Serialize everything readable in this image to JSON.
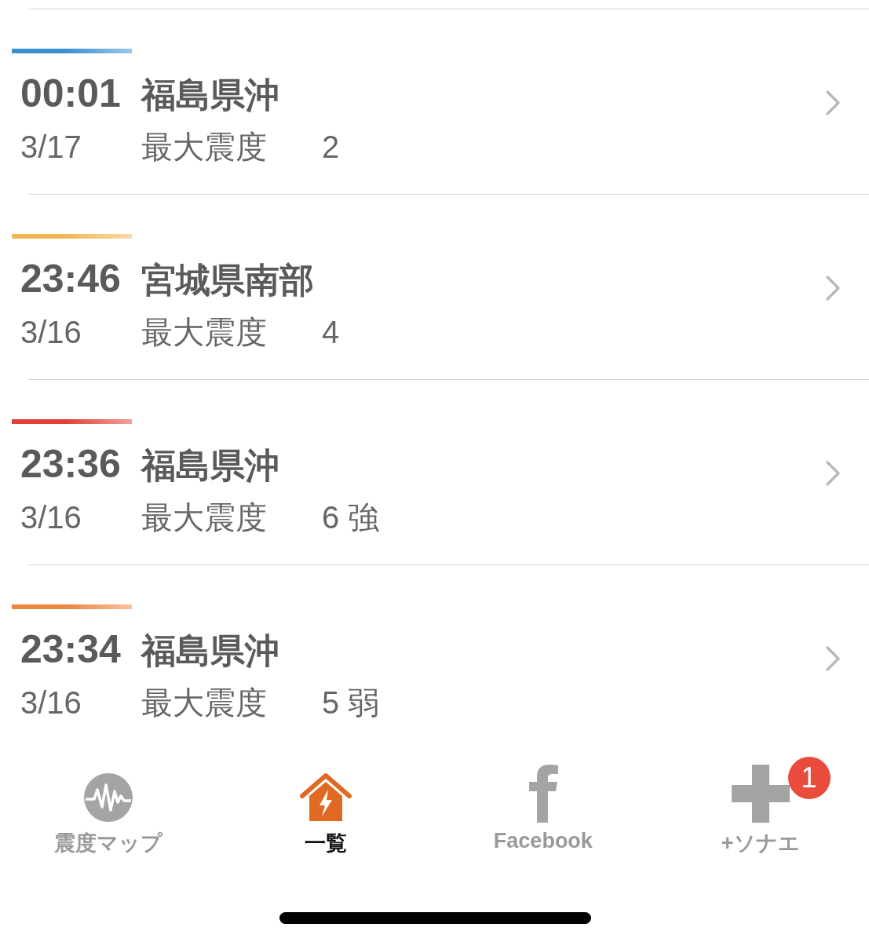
{
  "events": [
    {
      "time": "00:01",
      "place": "福島県沖",
      "date": "3/17",
      "label": "最大震度",
      "intensity": "2",
      "color": "#3a8fd0"
    },
    {
      "time": "23:46",
      "place": "宮城県南部",
      "date": "3/16",
      "label": "最大震度",
      "intensity": "4",
      "color": "#f2b652"
    },
    {
      "time": "23:36",
      "place": "福島県沖",
      "date": "3/16",
      "label": "最大震度",
      "intensity": "6 強",
      "color": "#e0423a"
    },
    {
      "time": "23:34",
      "place": "福島県沖",
      "date": "3/16",
      "label": "最大震度",
      "intensity": "5 弱",
      "color": "#ee8540"
    }
  ],
  "tab_bar": [
    {
      "kind": "map",
      "label": "震度マップ",
      "selected": false
    },
    {
      "kind": "list",
      "label": "一覧",
      "selected": true
    },
    {
      "kind": "facebook",
      "label": "Facebook",
      "selected": false
    },
    {
      "kind": "plus",
      "label": "+ソナエ",
      "selected": false,
      "badge": "1"
    }
  ]
}
